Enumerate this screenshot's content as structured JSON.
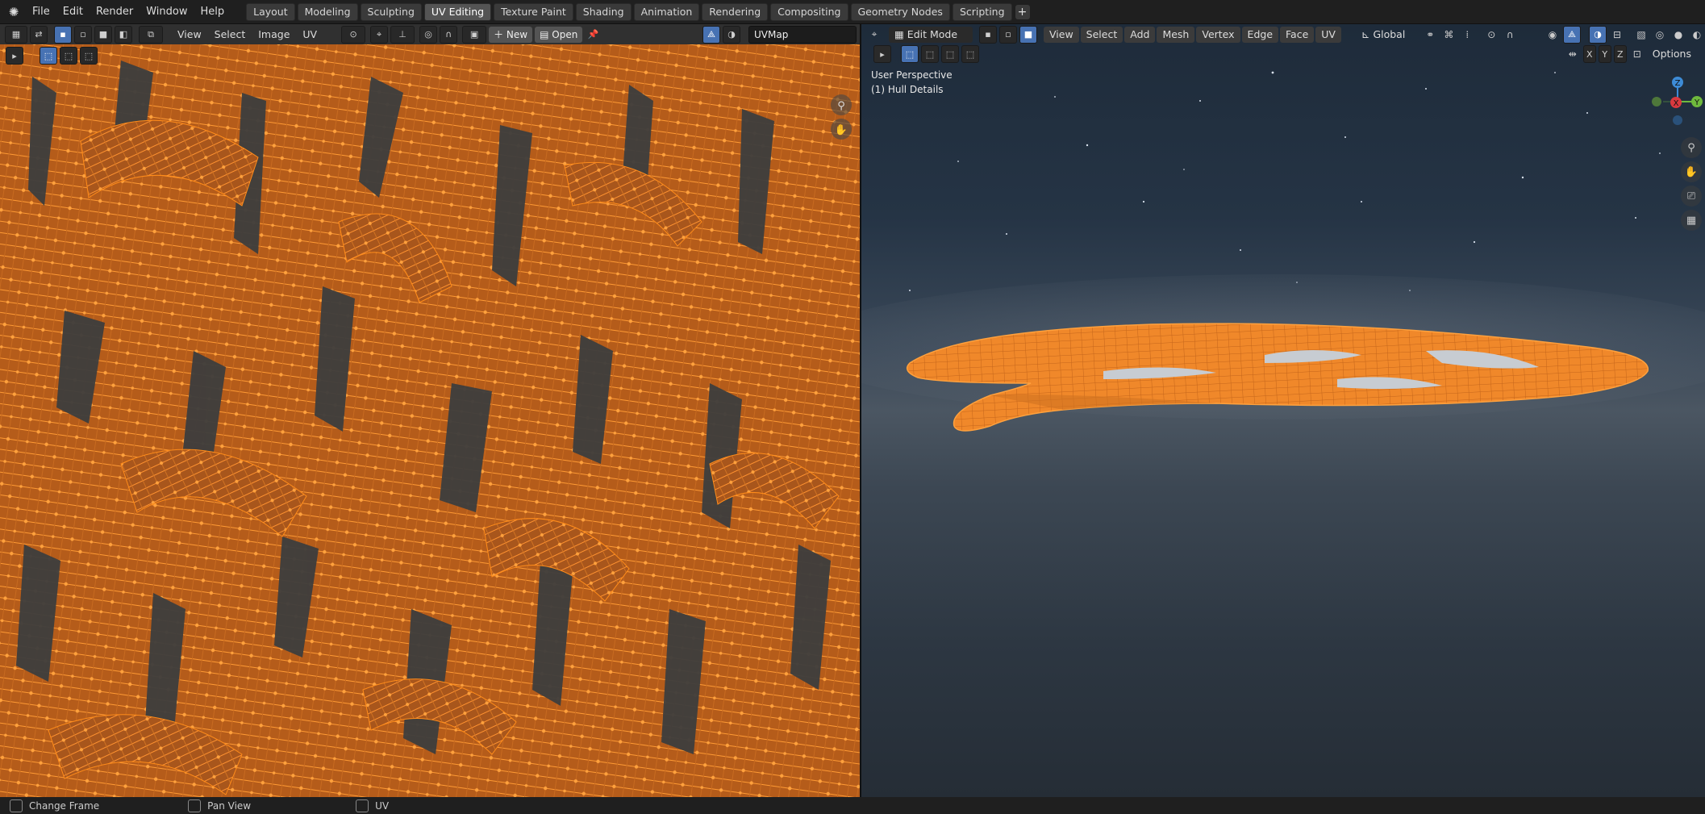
{
  "menu": [
    "File",
    "Edit",
    "Render",
    "Window",
    "Help"
  ],
  "workspaces": [
    {
      "label": "Layout",
      "active": false
    },
    {
      "label": "Modeling",
      "active": false
    },
    {
      "label": "Sculpting",
      "active": false
    },
    {
      "label": "UV Editing",
      "active": true
    },
    {
      "label": "Texture Paint",
      "active": false
    },
    {
      "label": "Shading",
      "active": false
    },
    {
      "label": "Animation",
      "active": false
    },
    {
      "label": "Rendering",
      "active": false
    },
    {
      "label": "Compositing",
      "active": false
    },
    {
      "label": "Geometry Nodes",
      "active": false
    },
    {
      "label": "Scripting",
      "active": false
    }
  ],
  "add_workspace": "+",
  "uv_editor": {
    "menus": [
      "View",
      "Select",
      "Image",
      "UV"
    ],
    "new_label": "New",
    "open_label": "Open",
    "uvmap_field": "UVMap"
  },
  "viewport": {
    "mode": "Edit Mode",
    "menus": [
      "View",
      "Select",
      "Add",
      "Mesh",
      "Vertex",
      "Edge",
      "Face",
      "UV"
    ],
    "orientation": "Global",
    "perspective": "User Perspective",
    "object": "(1) Hull Details",
    "options_label": "Options",
    "axis_x": "X",
    "axis_y": "Y",
    "axis_z": "Z",
    "gizmo": {
      "z": "Z",
      "y": "Y",
      "x": "X"
    }
  },
  "status": [
    {
      "label": "Change Frame"
    },
    {
      "label": "Pan View"
    },
    {
      "label": "UV"
    }
  ],
  "colors": {
    "accent": "#4772b3",
    "uv_orange": "#ff8c1a",
    "active_tab": "#545454"
  }
}
